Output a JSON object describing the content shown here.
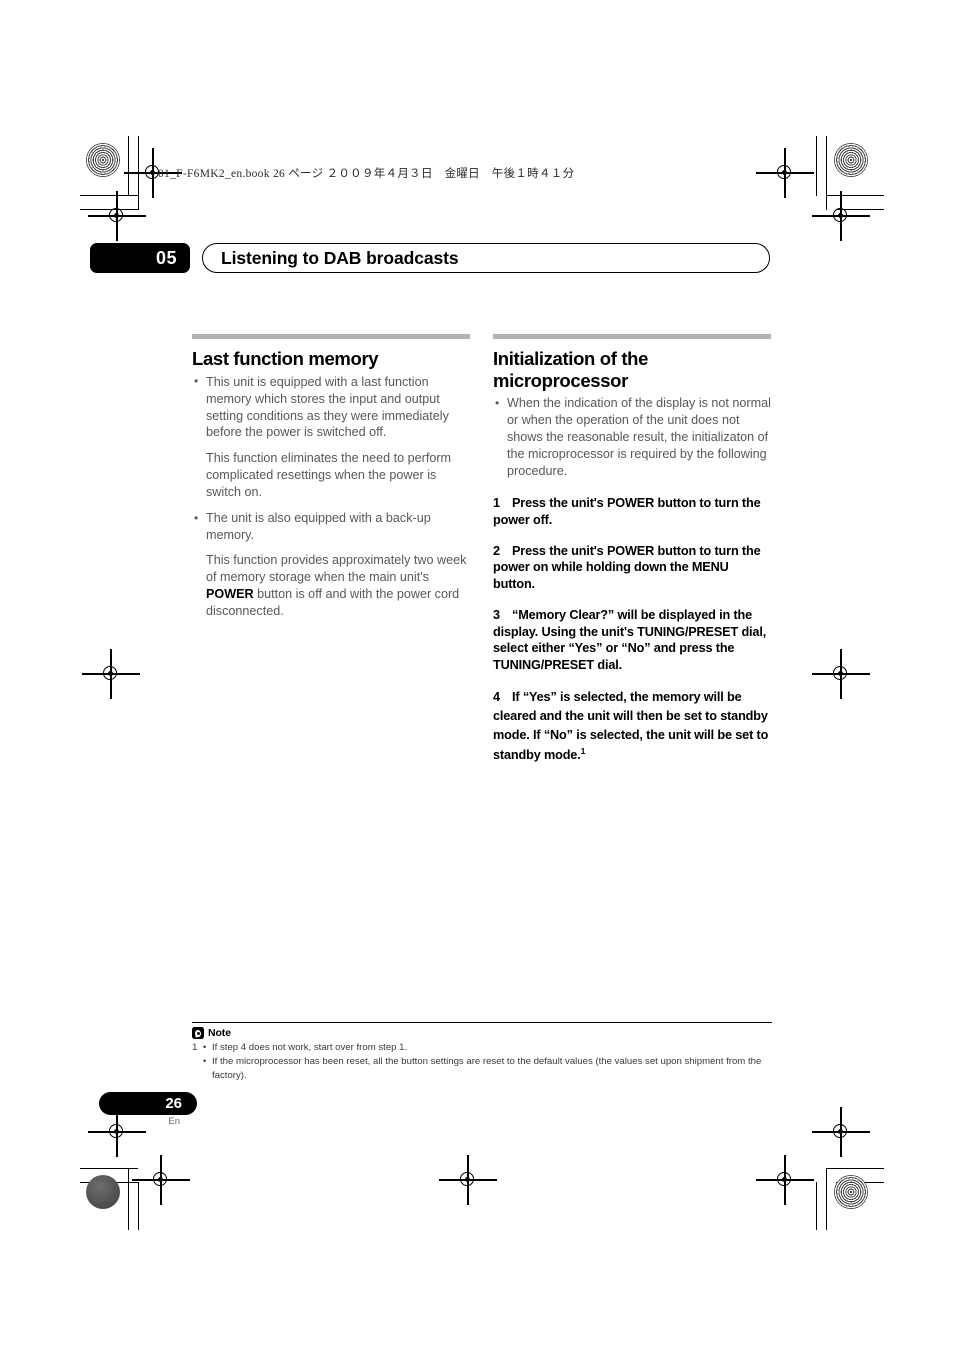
{
  "file_header": "01_F-F6MK2_en.book  26 ページ  ２００９年４月３日　金曜日　午後１時４１分",
  "chapter": {
    "number": "05",
    "title": "Listening to DAB broadcasts"
  },
  "left_column": {
    "heading": "Last function memory",
    "bullet1": "This unit is equipped with a last function memory which stores the input and output setting conditions as they were immediately before the power is switched off.",
    "bullet1_cont": "This function eliminates the need to perform complicated resettings when the power is switch on.",
    "bullet2": "The unit is also equipped with a back-up memory.",
    "bullet2_cont_a": "This function provides approximately two week of memory storage when the main unit's ",
    "bullet2_keyword": "POWER",
    "bullet2_cont_b": " button is off and with the power cord disconnected."
  },
  "right_column": {
    "heading_line1": "Initialization of the",
    "heading_line2": "microprocessor",
    "bullet1": "When the indication of the display is not normal or when the operation of the unit does not shows the reasonable result, the initializaton of the microprocessor is required by the following procedure.",
    "steps": [
      {
        "num": "1",
        "text": "Press the unit's POWER button to turn the power off."
      },
      {
        "num": "2",
        "text": "Press the unit's POWER button to turn the power on while holding down the MENU button."
      },
      {
        "num": "3",
        "text": "“Memory Clear?” will be displayed in the display. Using the unit's TUNING/PRESET dial, select either “Yes” or “No” and press the TUNING/PRESET dial."
      },
      {
        "num": "4",
        "text": "If “Yes” is selected, the memory will be cleared and the unit will then be set to standby mode. If “No” is selected, the unit will be set to standby mode.",
        "footnote_ref": "1"
      }
    ]
  },
  "note": {
    "label": "Note",
    "items": [
      {
        "marker": "1",
        "bullet": "•",
        "text": "If step 4 does not work, start over from step 1."
      },
      {
        "marker": "",
        "bullet": "•",
        "text": "If the microprocessor has been reset, all the button settings are reset to the default values (the values set upon shipment from the factory)."
      }
    ]
  },
  "footer": {
    "page_number": "26",
    "language": "En"
  },
  "colors": {
    "body_text": "#58585a",
    "rule": "#b3b3b3",
    "accent": "#000000"
  }
}
